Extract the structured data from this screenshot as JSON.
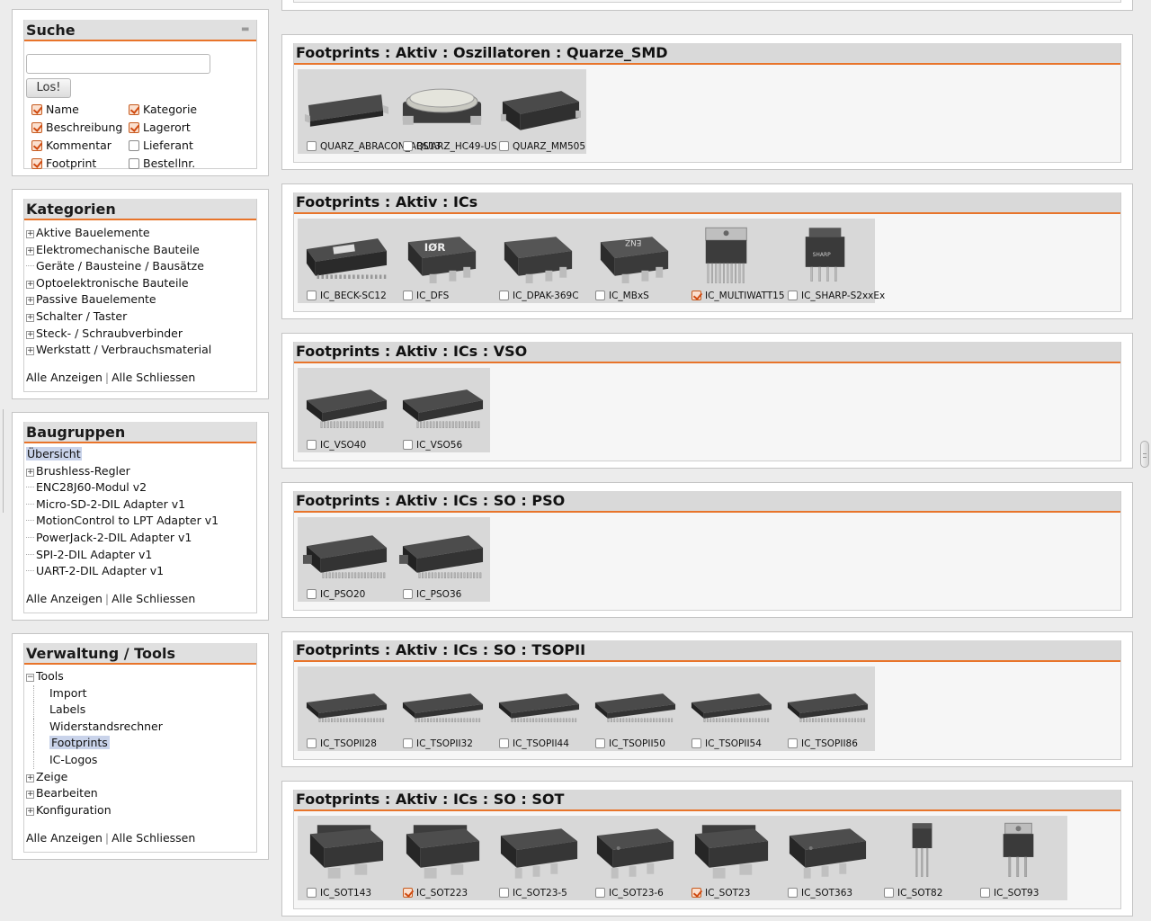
{
  "search": {
    "title": "Suche",
    "input_value": "",
    "button_label": "Los!",
    "options": [
      {
        "label": "Name",
        "checked": true
      },
      {
        "label": "Kategorie",
        "checked": true
      },
      {
        "label": "Beschreibung",
        "checked": true
      },
      {
        "label": "Lagerort",
        "checked": true
      },
      {
        "label": "Kommentar",
        "checked": true
      },
      {
        "label": "Lieferant",
        "checked": false
      },
      {
        "label": "Footprint",
        "checked": true
      },
      {
        "label": "Bestellnr.",
        "checked": false
      }
    ]
  },
  "categories": {
    "title": "Kategorien",
    "items": [
      "Aktive Bauelemente",
      "Elektromechanische Bauteile",
      "Geräte / Bausteine / Bausätze",
      "Optoelektronische Bauteile",
      "Passive Bauelemente",
      "Schalter / Taster",
      "Steck- / Schraubverbinder",
      "Werkstatt / Verbrauchsmaterial"
    ],
    "show_all": "Alle Anzeigen",
    "close_all": "Alle Schliessen"
  },
  "assemblies": {
    "title": "Baugruppen",
    "overview": "Übersicht",
    "items": [
      "Brushless-Regler",
      "ENC28J60-Modul v2",
      "Micro-SD-2-DIL Adapter v1",
      "MotionControl to LPT Adapter v1",
      "PowerJack-2-DIL Adapter v1",
      "SPI-2-DIL Adapter v1",
      "UART-2-DIL Adapter v1"
    ],
    "show_all": "Alle Anzeigen",
    "close_all": "Alle Schliessen"
  },
  "tools": {
    "title": "Verwaltung / Tools",
    "root": "Tools",
    "children": [
      "Import",
      "Labels",
      "Widerstandsrechner",
      "Footprints",
      "IC-Logos"
    ],
    "selected": "Footprints",
    "others": [
      "Zeige",
      "Bearbeiten",
      "Konfiguration"
    ],
    "show_all": "Alle Anzeigen",
    "close_all": "Alle Schliessen"
  },
  "footprint_groups": [
    {
      "title": "Footprints : Aktiv : Oszillatoren : Quarze_SMD",
      "items": [
        {
          "name": "QUARZ_ABRACON_ABS13",
          "checked": false,
          "shape": "flat-chip"
        },
        {
          "name": "QUARZ_HC49-US",
          "checked": false,
          "shape": "crystal"
        },
        {
          "name": "QUARZ_MM505",
          "checked": false,
          "shape": "block"
        }
      ]
    },
    {
      "title": "Footprints : Aktiv : ICs",
      "items": [
        {
          "name": "IC_BECK-SC12",
          "checked": false,
          "shape": "dip-chip"
        },
        {
          "name": "IC_DFS",
          "checked": false,
          "shape": "dpak-logo"
        },
        {
          "name": "IC_DPAK-369C",
          "checked": false,
          "shape": "dpak"
        },
        {
          "name": "IC_MBxS",
          "checked": false,
          "shape": "dpak-marked"
        },
        {
          "name": "IC_MULTIWATT15",
          "checked": true,
          "shape": "multiwatt"
        },
        {
          "name": "IC_SHARP-S2xxEx",
          "checked": false,
          "shape": "to220-sharp"
        }
      ]
    },
    {
      "title": "Footprints : Aktiv : ICs : VSO",
      "items": [
        {
          "name": "IC_VSO40",
          "checked": false,
          "shape": "so-wide"
        },
        {
          "name": "IC_VSO56",
          "checked": false,
          "shape": "so-wide"
        }
      ]
    },
    {
      "title": "Footprints : Aktiv : ICs : SO : PSO",
      "items": [
        {
          "name": "IC_PSO20",
          "checked": false,
          "shape": "pso"
        },
        {
          "name": "IC_PSO36",
          "checked": false,
          "shape": "pso"
        }
      ]
    },
    {
      "title": "Footprints : Aktiv : ICs : SO : TSOPII",
      "items": [
        {
          "name": "IC_TSOPII28",
          "checked": false,
          "shape": "tsop"
        },
        {
          "name": "IC_TSOPII32",
          "checked": false,
          "shape": "tsop"
        },
        {
          "name": "IC_TSOPII44",
          "checked": false,
          "shape": "tsop"
        },
        {
          "name": "IC_TSOPII50",
          "checked": false,
          "shape": "tsop"
        },
        {
          "name": "IC_TSOPII54",
          "checked": false,
          "shape": "tsop"
        },
        {
          "name": "IC_TSOPII86",
          "checked": false,
          "shape": "tsop"
        }
      ]
    },
    {
      "title": "Footprints : Aktiv : ICs : SO : SOT",
      "items": [
        {
          "name": "IC_SOT143",
          "checked": false,
          "shape": "sot-big"
        },
        {
          "name": "IC_SOT223",
          "checked": true,
          "shape": "sot-big"
        },
        {
          "name": "IC_SOT23-5",
          "checked": false,
          "shape": "sot-5"
        },
        {
          "name": "IC_SOT23-6",
          "checked": false,
          "shape": "sot-6"
        },
        {
          "name": "IC_SOT23",
          "checked": true,
          "shape": "sot-big"
        },
        {
          "name": "IC_SOT363",
          "checked": false,
          "shape": "sot-6"
        },
        {
          "name": "IC_SOT82",
          "checked": false,
          "shape": "to-vertical"
        },
        {
          "name": "IC_SOT93",
          "checked": false,
          "shape": "to-tab"
        }
      ]
    }
  ]
}
